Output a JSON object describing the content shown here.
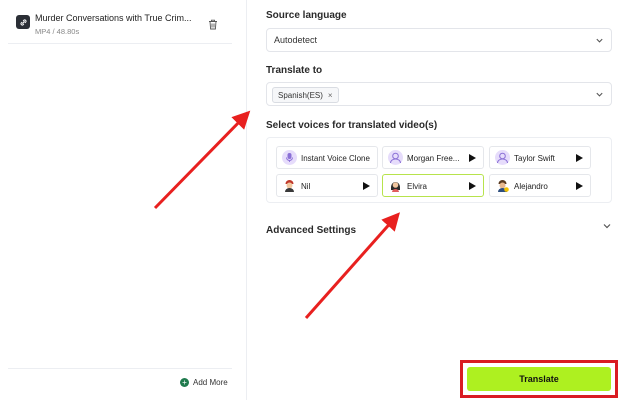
{
  "file": {
    "title": "Murder Conversations with True Crim...",
    "meta": "MP4 / 48.80s",
    "thumb_icon": "link-icon",
    "delete_icon": "trash-icon"
  },
  "left_footer": {
    "add_more_label": "Add More",
    "add_more_icon": "plus-circle-icon"
  },
  "source_language": {
    "label": "Source language",
    "value": "Autodetect"
  },
  "translate_to": {
    "label": "Translate to",
    "tag": "Spanish(ES)",
    "tag_remove": "×"
  },
  "voices": {
    "label": "Select voices for translated video(s)",
    "items": [
      {
        "name": "Instant Voice Clone",
        "avatar": "microphone-avatar",
        "color": "#c9b6f2"
      },
      {
        "name": "Morgan Free...",
        "avatar": "person-avatar",
        "color": "#c9b6f2"
      },
      {
        "name": "Taylor Swift",
        "avatar": "person-avatar",
        "color": "#c9b6f2"
      },
      {
        "name": "Nil",
        "avatar": "cartoon-man-avatar",
        "color": "#f0c9a8"
      },
      {
        "name": "Elvira",
        "avatar": "cartoon-woman-avatar",
        "color": "#f0c9a8",
        "selected": true
      },
      {
        "name": "Alejandro",
        "avatar": "cartoon-man-avatar",
        "color": "#f0c9a8"
      }
    ]
  },
  "advanced": {
    "label": "Advanced Settings"
  },
  "actions": {
    "translate_label": "Translate"
  },
  "colors": {
    "accent": "#aef020",
    "selected_border": "#b7e34c",
    "annotation_red": "#d91c23"
  }
}
